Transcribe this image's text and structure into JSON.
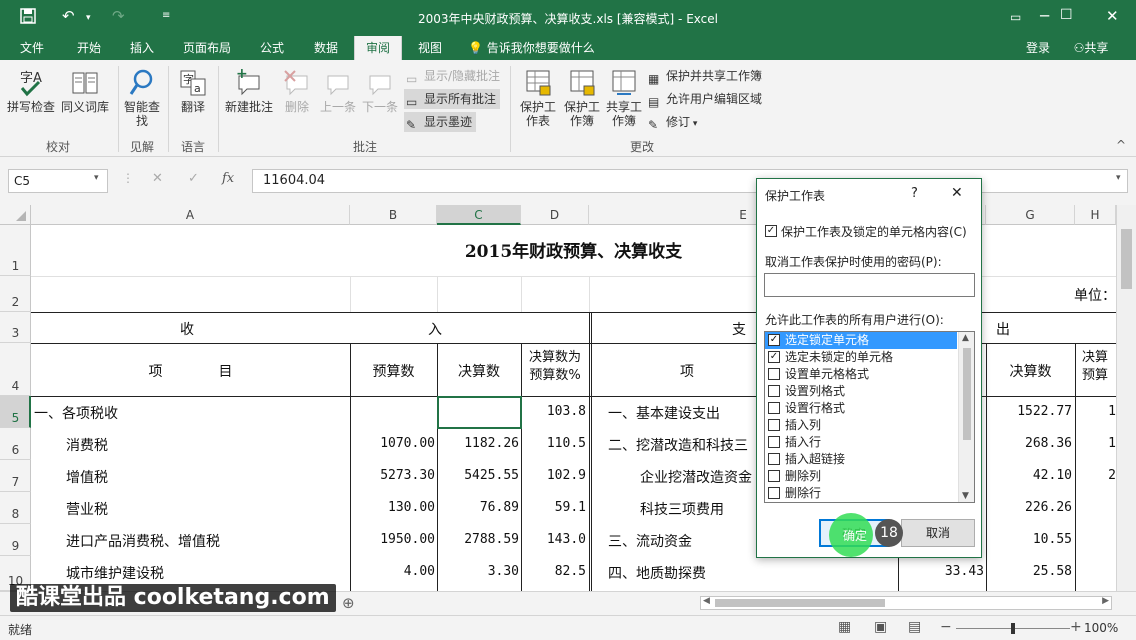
{
  "window": {
    "title": "2003年中央财政预算、决算收支.xls  [兼容模式] - Excel"
  },
  "tabs": [
    "文件",
    "开始",
    "插入",
    "页面布局",
    "公式",
    "数据",
    "审阅",
    "视图"
  ],
  "active_tab": "审阅",
  "tell_me": "告诉我你想要做什么",
  "account": {
    "login": "登录",
    "share": "共享"
  },
  "ribbon": {
    "spell": "拼写检查",
    "thesaurus": "同义词库",
    "group_proof": "校对",
    "smart_lookup": "智能查找",
    "group_insights": "见解",
    "translate": "翻译",
    "group_language": "语言",
    "new_comment": "新建批注",
    "delete": "删除",
    "prev": "上一条",
    "next": "下一条",
    "show_hide": "显示/隐藏批注",
    "show_all": "显示所有批注",
    "show_ink": "显示墨迹",
    "group_comments": "批注",
    "protect_sheet": "保护工作表",
    "protect_workbook": "保护工作簿",
    "share_workbook": "共享工作簿",
    "protect_share": "保护并共享工作簿",
    "allow_edit": "允许用户编辑区域",
    "track": "修订",
    "group_changes": "更改"
  },
  "formula_bar": {
    "name_box": "C5",
    "fx": "fx",
    "value": "11604.04"
  },
  "columns": [
    "A",
    "B",
    "C",
    "D",
    "E",
    "F",
    "G",
    "H"
  ],
  "rows": [
    "1",
    "2",
    "3",
    "4",
    "5",
    "6",
    "7",
    "8",
    "9",
    "10"
  ],
  "sheet": {
    "title": "2015年财政预算、决算收支",
    "unit": "单位：",
    "income_left": "收",
    "income_right": "入",
    "expense_left": "支",
    "expense_right": "出",
    "hdr_item": "项　　　　目",
    "hdr_budget": "预算数",
    "hdr_final": "决算数",
    "hdr_ratio": "决算数为预算数%",
    "hdr_item2": "项",
    "hdr_final2": "决算数",
    "hdr_h": "决算预算",
    "income": [
      {
        "item": "一、各项税收",
        "b": "",
        "c": "",
        "d": "103.8"
      },
      {
        "item": "消费税",
        "b": "1070.00",
        "c": "1182.26",
        "d": "110.5"
      },
      {
        "item": "增值税",
        "b": "5273.30",
        "c": "5425.55",
        "d": "102.9"
      },
      {
        "item": "营业税",
        "b": "130.00",
        "c": "76.89",
        "d": "59.1"
      },
      {
        "item": "进口产品消费税、增值税",
        "b": "1950.00",
        "c": "2788.59",
        "d": "143.0"
      },
      {
        "item": "城市维护建设税",
        "b": "4.00",
        "c": "3.30",
        "d": "82.5"
      }
    ],
    "expense": [
      {
        "item": "一、基本建设支出",
        "f": "",
        "g": "1522.77",
        "h": "1"
      },
      {
        "item": "二、挖潜改造和科技三",
        "f": "",
        "g": "268.36",
        "h": "1"
      },
      {
        "item": "企业挖潜改造资金",
        "f": "",
        "g": "42.10",
        "h": "2"
      },
      {
        "item": "科技三项费用",
        "f": "",
        "g": "226.26",
        "h": ""
      },
      {
        "item": "三、流动资金",
        "f": "",
        "g": "10.55",
        "h": ""
      },
      {
        "item": "四、地质勘探费",
        "f": "33.43",
        "g": "25.58",
        "h": ""
      }
    ]
  },
  "status": {
    "ready": "就绪",
    "zoom": "100%",
    "watermark": "酷课堂出品 coolketang.com"
  },
  "dialog": {
    "title": "保护工作表",
    "help": "?",
    "protect_check": "保护工作表及锁定的单元格内容(C)",
    "password_label": "取消工作表保护时使用的密码(P):",
    "password_value": "",
    "allow_label": "允许此工作表的所有用户进行(O):",
    "options": [
      {
        "label": "选定锁定单元格",
        "checked": true
      },
      {
        "label": "选定未锁定的单元格",
        "checked": true
      },
      {
        "label": "设置单元格格式",
        "checked": false
      },
      {
        "label": "设置列格式",
        "checked": false
      },
      {
        "label": "设置行格式",
        "checked": false
      },
      {
        "label": "插入列",
        "checked": false
      },
      {
        "label": "插入行",
        "checked": false
      },
      {
        "label": "插入超链接",
        "checked": false
      },
      {
        "label": "删除列",
        "checked": false
      },
      {
        "label": "删除行",
        "checked": false
      }
    ],
    "ok": "确定",
    "cancel": "取消",
    "step_badge": "18"
  },
  "colors": {
    "brand": "#217346",
    "highlight": "#3399ff",
    "pointer": "#33dd55"
  }
}
